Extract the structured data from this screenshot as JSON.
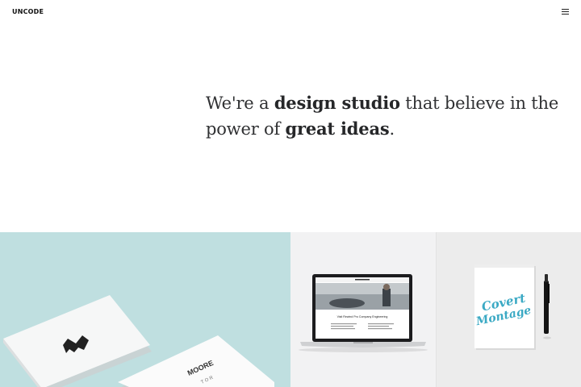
{
  "header": {
    "logo": "UNCODE",
    "menu_icon": "hamburger-menu-icon"
  },
  "hero": {
    "line1_pre": "We're a ",
    "line1_bold": "design studio",
    "line1_post": " that believe in the",
    "line2_pre": "power of ",
    "line2_bold": "great ideas",
    "line2_post": "."
  },
  "gallery": {
    "tiles": [
      {
        "subject": "business-cards-mockup",
        "card_text_1": "MOORE",
        "card_text_2": "T O R"
      },
      {
        "subject": "laptop-website-mockup",
        "screen_heading": "Visit Rewind Pro Company Engineering"
      },
      {
        "subject": "notepad-lettering-mockup",
        "lettering_1": "Covert",
        "lettering_2": "Montage"
      }
    ],
    "colors": {
      "cards_bg": "#bfdfe0",
      "laptop_bg": "#f2f2f3",
      "notepad_bg": "#ececec",
      "lettering": "#3aa9c4"
    }
  }
}
